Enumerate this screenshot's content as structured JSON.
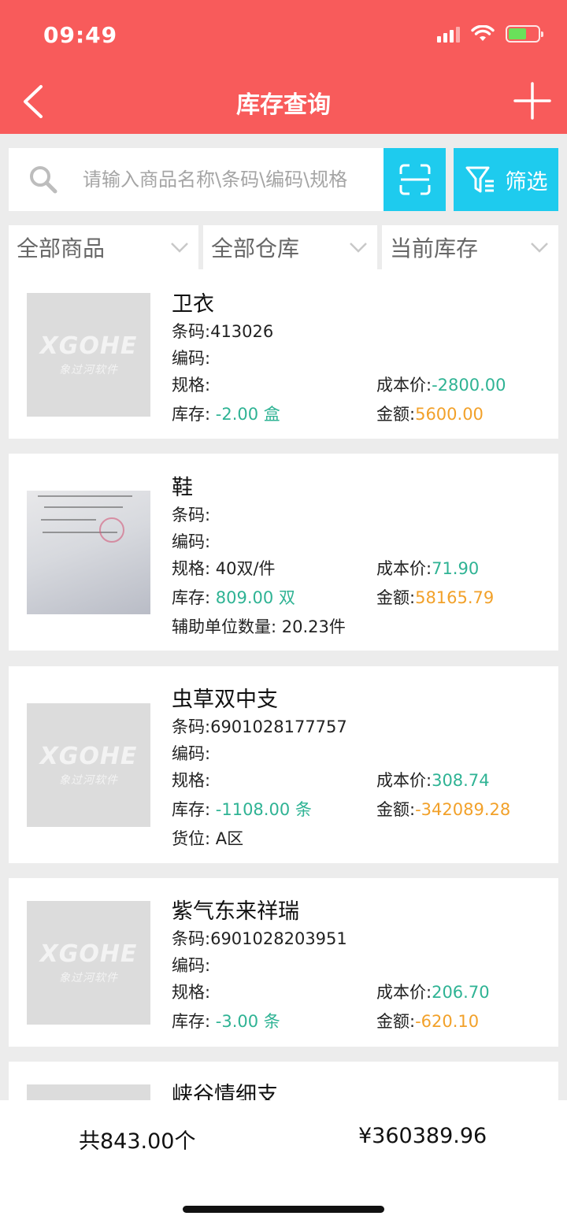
{
  "status": {
    "time": "09:49"
  },
  "nav": {
    "title": "库存查询"
  },
  "search": {
    "placeholder": "请输入商品名称\\条码\\编码\\规格"
  },
  "filter": {
    "label": "筛选"
  },
  "dropdowns": [
    {
      "label": "全部商品"
    },
    {
      "label": "全部仓库"
    },
    {
      "label": "当前库存"
    }
  ],
  "labels": {
    "barcode": "条码:",
    "code": "编码:",
    "spec": "规格:",
    "stock": "库存:",
    "cost": "成本价:",
    "amount": "金额:"
  },
  "items": [
    {
      "name": "卫衣",
      "barcode": "413026",
      "code": "",
      "spec": "",
      "cost": "-2800.00",
      "stock": "-2.00 盒",
      "amount": "5600.00",
      "image": "logo"
    },
    {
      "name": "鞋",
      "barcode": "",
      "code": "",
      "spec": "40双/件",
      "cost": "71.90",
      "stock": "809.00 双",
      "amount": "58165.79",
      "extra": "辅助单位数量: 20.23件",
      "image": "photo"
    },
    {
      "name": "虫草双中支",
      "barcode": "6901028177757",
      "code": "",
      "spec": "",
      "cost": "308.74",
      "stock": "-1108.00 条",
      "amount": "-342089.28",
      "extra": "货位: A区",
      "image": "logo"
    },
    {
      "name": "紫气东来祥瑞",
      "barcode": "6901028203951",
      "code": "",
      "spec": "",
      "cost": "206.70",
      "stock": "-3.00 条",
      "amount": "-620.10",
      "image": "logo"
    },
    {
      "name": "峡谷情细支",
      "image": "logo"
    }
  ],
  "logo": {
    "main": "XGOHE",
    "sub": "象过河软件"
  },
  "footer": {
    "total_count": "共843.00个",
    "total_amount": "¥360389.96"
  },
  "colors": {
    "header": "#f85b5b",
    "accent": "#1ecbee",
    "teal": "#2fb394",
    "orange": "#f2a12a"
  }
}
